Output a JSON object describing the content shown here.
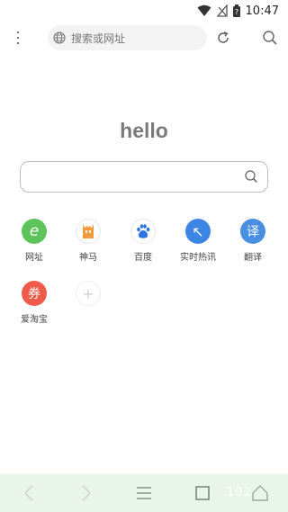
{
  "status": {
    "time": "10:47"
  },
  "address_bar": {
    "placeholder": "搜索或网址"
  },
  "home": {
    "title": "hello"
  },
  "shortcuts": [
    {
      "label": "网址",
      "glyph": "e",
      "color": "#5cc45a"
    },
    {
      "label": "神马",
      "glyph": "",
      "color": "#ffffff"
    },
    {
      "label": "百度",
      "glyph": "",
      "color": "#ffffff"
    },
    {
      "label": "实时热讯",
      "glyph": "↖",
      "color": "#3e86e6"
    },
    {
      "label": "翻译",
      "glyph": "译",
      "color": "#4a90e2"
    },
    {
      "label": "爱淘宝",
      "glyph": "券",
      "color": "#f05a4a"
    },
    {
      "label": "",
      "glyph": "+",
      "color": "#ffffff"
    }
  ],
  "watermark": "192"
}
